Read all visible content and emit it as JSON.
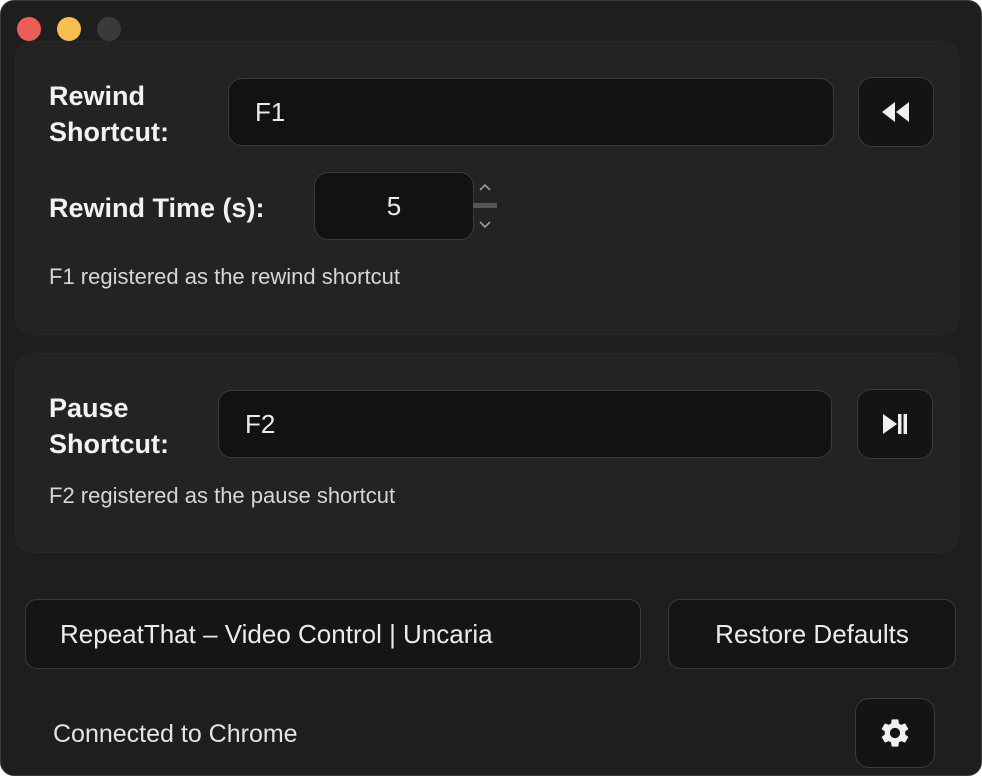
{
  "rewind": {
    "label": "Rewind\nShortcut:",
    "shortcut_value": "F1",
    "time_label": "Rewind Time (s):",
    "time_value": "5",
    "status": "F1 registered as the rewind shortcut"
  },
  "pause": {
    "label": "Pause\nShortcut:",
    "shortcut_value": "F2",
    "status": "F2 registered as the pause shortcut"
  },
  "bottom": {
    "app_link_label": "RepeatThat – Video Control | Uncaria",
    "restore_label": "Restore Defaults",
    "connection_status": "Connected to Chrome"
  },
  "icons": {
    "rewind": "rewind-icon",
    "play_pause": "play-pause-icon",
    "settings": "gear-icon"
  },
  "colors": {
    "close": "#ec5f58",
    "minimize": "#f5be4f",
    "window_bg": "#1e1e1e",
    "panel_bg": "#232323"
  }
}
